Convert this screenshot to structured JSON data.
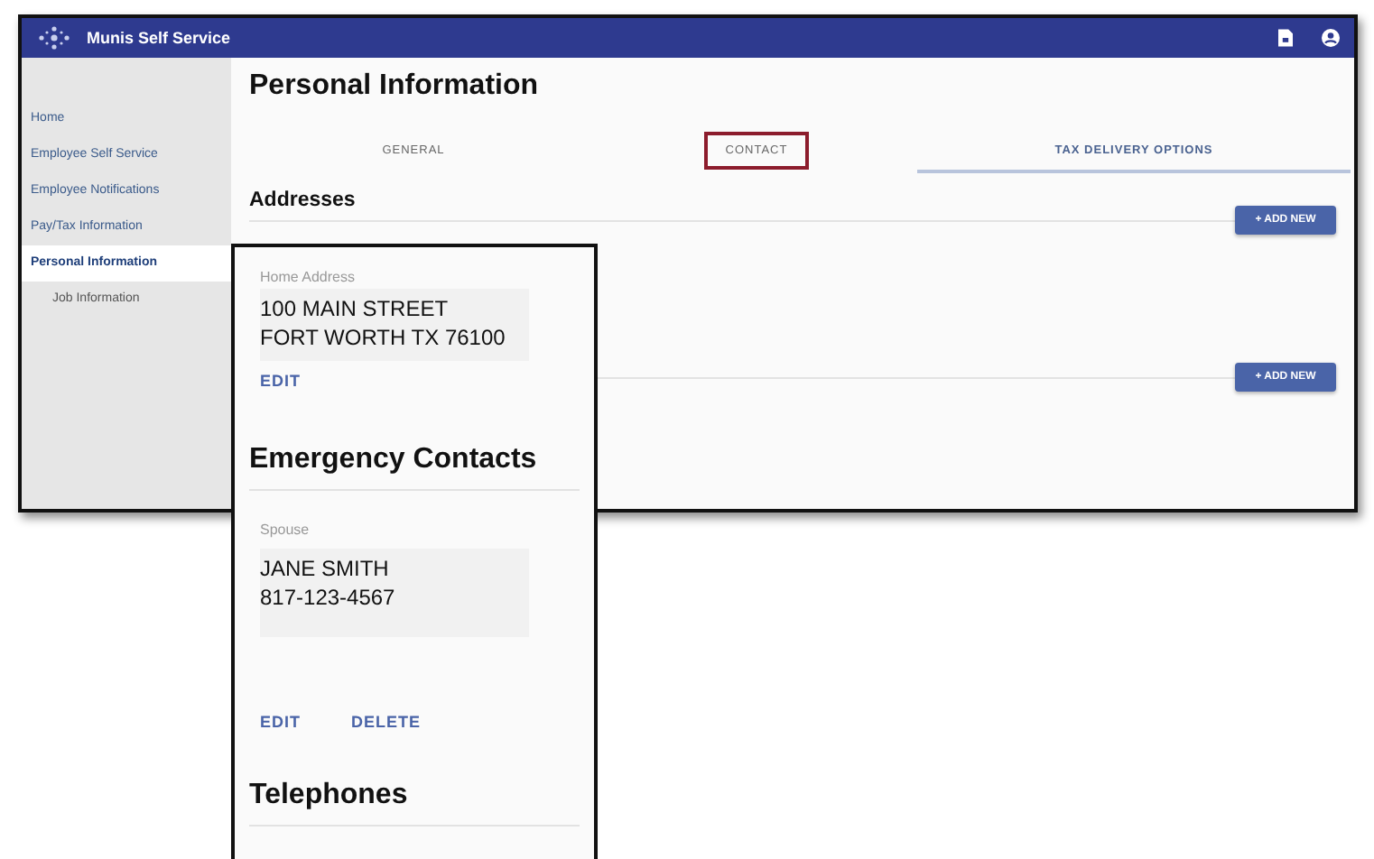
{
  "window": {
    "title": "Munis Self Service"
  },
  "sidebar": {
    "items": [
      {
        "label": "Home",
        "selected": false
      },
      {
        "label": "Employee Self Service",
        "selected": false
      },
      {
        "label": "Employee Notifications",
        "selected": false
      },
      {
        "label": "Pay/Tax Information",
        "selected": false
      },
      {
        "label": "Personal Information",
        "selected": true,
        "children": [
          {
            "label": "Job Information",
            "selected": false
          }
        ]
      }
    ]
  },
  "page": {
    "title": "Personal Information"
  },
  "tabs": [
    {
      "label": "GENERAL",
      "selected": false,
      "annotated": false
    },
    {
      "label": "CONTACT",
      "selected": false,
      "annotated": true
    },
    {
      "label": "TAX DELIVERY OPTIONS",
      "selected": true,
      "annotated": false
    }
  ],
  "sections": [
    {
      "heading": "Addresses",
      "button": "+ ADD NEW"
    },
    {
      "button": "+ ADD NEW"
    }
  ],
  "overlay_card": {
    "address": {
      "label": "Home Address",
      "lines": [
        "100 MAIN STREET",
        "FORT WORTH TX 76100"
      ],
      "actions": [
        "EDIT"
      ]
    },
    "emergency": {
      "heading": "Emergency Contacts",
      "contacts": [
        {
          "relation": "Spouse",
          "lines": [
            "JANE SMITH",
            "817-123-4567"
          ],
          "actions": [
            "EDIT",
            "DELETE"
          ]
        }
      ]
    },
    "telephones": {
      "heading": "Telephones"
    }
  }
}
